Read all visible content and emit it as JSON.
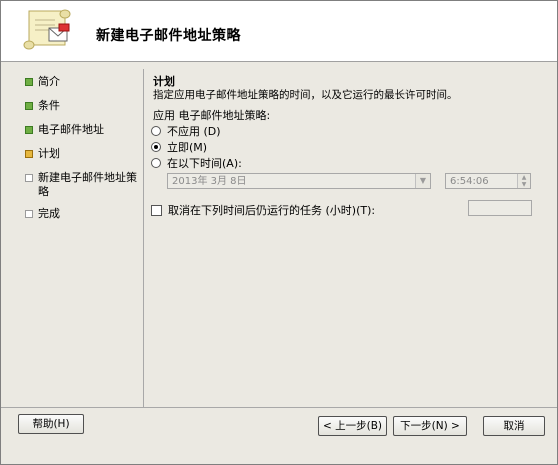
{
  "window": {
    "title": "新建电子邮件地址策略"
  },
  "steps": [
    {
      "label": "简介",
      "state": "done"
    },
    {
      "label": "条件",
      "state": "done"
    },
    {
      "label": "电子邮件地址",
      "state": "done"
    },
    {
      "label": "计划",
      "state": "current"
    },
    {
      "label": "新建电子邮件地址策\n略",
      "state": "todo"
    },
    {
      "label": "完成",
      "state": "todo"
    }
  ],
  "schedule": {
    "title": "计划",
    "description": "指定应用电子邮件地址策略的时间，以及它运行的最长许可时间。",
    "apply_label": "应用 电子邮件地址策略:",
    "options": [
      {
        "label": "不应用 (D)",
        "selected": false
      },
      {
        "label": "立即(M)",
        "selected": true
      },
      {
        "label": "在以下时间(A):",
        "selected": false
      }
    ],
    "date_value": "2013年  3月  8日",
    "time_value": "6:54:06",
    "cancel_checkbox_label": "取消在下列时间后仍运行的任务 (小时)(T):",
    "cancel_checkbox_checked": false,
    "hours_value": ""
  },
  "buttons": {
    "help": "帮助(H)",
    "back": "< 上一步(B)",
    "next": "下一步(N) >",
    "cancel": "取消"
  },
  "colors": {
    "done": "#6fae43",
    "current": "#e6b73e",
    "todo": "#ffffff"
  }
}
